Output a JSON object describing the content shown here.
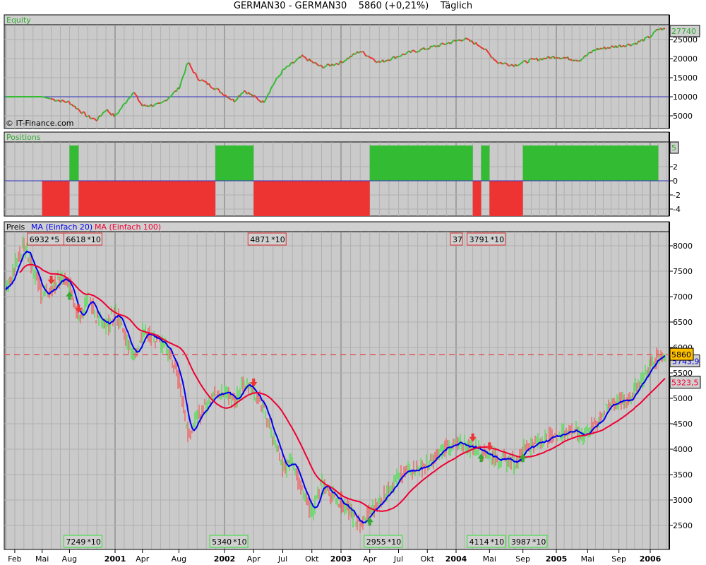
{
  "title": {
    "symbol": "GERMAN30 - GERMAN30",
    "last": "5860 (+0,21%)",
    "period": "Täglich"
  },
  "colors": {
    "up": "#33bb33",
    "down": "#ee3333",
    "ma20": "#0000ee",
    "ma100": "#ee0033",
    "panel_bg": "#cacaca",
    "last_box": "#ffc000"
  },
  "chart_data": [
    {
      "type": "line",
      "panel": "Equity",
      "title": "Equity",
      "watermark": "© IT-Finance.com",
      "y_ticks": [
        5000,
        10000,
        15000,
        20000,
        25000
      ],
      "ylim": [
        2000,
        28500
      ],
      "reference_line": 10000,
      "last_value": "27740",
      "series": [
        {
          "name": "Equity",
          "points": [
            [
              "2000-01",
              10000
            ],
            [
              "2000-05",
              10000
            ],
            [
              "2000-06",
              9440
            ],
            [
              "2000-08",
              8500
            ],
            [
              "2000-10",
              4800
            ],
            [
              "2000-11",
              3900
            ],
            [
              "2000-12",
              6670
            ],
            [
              "2001-01",
              4800
            ],
            [
              "2001-03",
              11300
            ],
            [
              "2001-04",
              7600
            ],
            [
              "2001-06",
              7960
            ],
            [
              "2001-08",
              12200
            ],
            [
              "2001-09",
              19070
            ],
            [
              "2001-10",
              15000
            ],
            [
              "2001-12",
              12200
            ],
            [
              "2002-02",
              8900
            ],
            [
              "2002-03",
              11670
            ],
            [
              "2002-05",
              8500
            ],
            [
              "2002-06",
              13150
            ],
            [
              "2002-07",
              16850
            ],
            [
              "2002-09",
              20550
            ],
            [
              "2002-11",
              17780
            ],
            [
              "2003-01",
              19000
            ],
            [
              "2003-03",
              22000
            ],
            [
              "2003-05",
              19000
            ],
            [
              "2003-08",
              21500
            ],
            [
              "2003-11",
              23300
            ],
            [
              "2004-02",
              25200
            ],
            [
              "2004-04",
              23300
            ],
            [
              "2004-06",
              19000
            ],
            [
              "2004-08",
              18300
            ],
            [
              "2004-10",
              19600
            ],
            [
              "2005-01",
              20500
            ],
            [
              "2005-04",
              19600
            ],
            [
              "2005-06",
              22400
            ],
            [
              "2005-09",
              23300
            ],
            [
              "2005-11",
              23900
            ],
            [
              "2006-01",
              25700
            ],
            [
              "2006-02",
              27740
            ]
          ]
        }
      ]
    },
    {
      "type": "bar",
      "panel": "Positions",
      "title": "Positions",
      "y_ticks": [
        -4,
        -2,
        0,
        2
      ],
      "ylim": [
        -5,
        5
      ],
      "last_value": "5",
      "segments": [
        {
          "from": "2000-05",
          "to": "2000-08",
          "value": -5
        },
        {
          "from": "2000-08",
          "to": "2000-09",
          "value": 5
        },
        {
          "from": "2000-09",
          "to": "2001-12",
          "value": -5
        },
        {
          "from": "2001-12",
          "to": "2002-04",
          "value": 5
        },
        {
          "from": "2002-04",
          "to": "2003-04",
          "value": -5
        },
        {
          "from": "2003-04",
          "to": "2004-03",
          "value": 5
        },
        {
          "from": "2004-03",
          "to": "2004-04",
          "value": -5
        },
        {
          "from": "2004-04",
          "to": "2004-05",
          "value": 5
        },
        {
          "from": "2004-05",
          "to": "2004-09",
          "value": -5
        },
        {
          "from": "2004-09",
          "to": "2006-02",
          "value": 5
        }
      ]
    },
    {
      "type": "line",
      "panel": "Preis",
      "legend": [
        "Preis",
        "MA (Einfach 20)",
        "MA (Einfach 100)"
      ],
      "y_ticks": [
        2500,
        3000,
        3500,
        4000,
        4500,
        5000,
        5500,
        6000,
        6500,
        7000,
        7500,
        8000
      ],
      "ylim": [
        2300,
        8250
      ],
      "last_price": "5860",
      "ma20_last": "5743,9",
      "ma100_last": "5323,5",
      "price": [
        [
          "2000-01",
          7140
        ],
        [
          "2000-03",
          8040
        ],
        [
          "2000-04",
          7555
        ],
        [
          "2000-05",
          7000
        ],
        [
          "2000-06",
          7140
        ],
        [
          "2000-07",
          7350
        ],
        [
          "2000-08",
          7200
        ],
        [
          "2000-09",
          6580
        ],
        [
          "2000-10",
          7000
        ],
        [
          "2000-11",
          6580
        ],
        [
          "2000-12",
          6375
        ],
        [
          "2001-01",
          6720
        ],
        [
          "2001-03",
          5820
        ],
        [
          "2001-04",
          6300
        ],
        [
          "2001-05",
          6240
        ],
        [
          "2001-07",
          5890
        ],
        [
          "2001-08",
          5330
        ],
        [
          "2001-09",
          4220
        ],
        [
          "2001-10",
          4640
        ],
        [
          "2001-12",
          5125
        ],
        [
          "2002-01",
          5125
        ],
        [
          "2002-02",
          4920
        ],
        [
          "2002-03",
          5330
        ],
        [
          "2002-04",
          5125
        ],
        [
          "2002-05",
          4780
        ],
        [
          "2002-06",
          4220
        ],
        [
          "2002-07",
          3600
        ],
        [
          "2002-08",
          3800
        ],
        [
          "2002-09",
          3110
        ],
        [
          "2002-10",
          2760
        ],
        [
          "2002-11",
          3320
        ],
        [
          "2002-12",
          3110
        ],
        [
          "2003-01",
          2970
        ],
        [
          "2003-03",
          2485
        ],
        [
          "2003-04",
          2760
        ],
        [
          "2003-05",
          2970
        ],
        [
          "2003-06",
          3250
        ],
        [
          "2003-08",
          3600
        ],
        [
          "2003-10",
          3670
        ],
        [
          "2003-12",
          4080
        ],
        [
          "2004-02",
          4080
        ],
        [
          "2004-04",
          4010
        ],
        [
          "2004-05",
          3870
        ],
        [
          "2004-08",
          3740
        ],
        [
          "2004-09",
          4010
        ],
        [
          "2004-11",
          4150
        ],
        [
          "2005-01",
          4290
        ],
        [
          "2005-03",
          4390
        ],
        [
          "2005-04",
          4250
        ],
        [
          "2005-06",
          4500
        ],
        [
          "2005-08",
          4920
        ],
        [
          "2005-10",
          4950
        ],
        [
          "2005-12",
          5400
        ],
        [
          "2006-02",
          5860
        ]
      ],
      "top_labels": [
        {
          "text": "6932",
          "mult": "*5",
          "date": "2000-04"
        },
        {
          "text": "6618",
          "mult": "*10",
          "date": "2000-08"
        },
        {
          "text": "4871",
          "mult": "*10",
          "date": "2002-04"
        },
        {
          "text": "37",
          "mult": "",
          "date": "2004-01"
        },
        {
          "text": "3791",
          "mult": "*10",
          "date": "2004-03"
        }
      ],
      "bottom_labels": [
        {
          "text": "7249",
          "mult": "*10",
          "date": "2000-08"
        },
        {
          "text": "5340",
          "mult": "*10",
          "date": "2001-12"
        },
        {
          "text": "2955",
          "mult": "*10",
          "date": "2003-04"
        },
        {
          "text": "4114",
          "mult": "*10",
          "date": "2004-03"
        },
        {
          "text": "3987",
          "mult": "*10",
          "date": "2004-08"
        }
      ],
      "signals": [
        {
          "date": "2000-08",
          "dir": "up"
        },
        {
          "date": "2000-09",
          "dir": "down"
        },
        {
          "date": "2000-06",
          "dir": "down"
        },
        {
          "date": "2002-04",
          "dir": "down"
        },
        {
          "date": "2003-04",
          "dir": "up"
        },
        {
          "date": "2004-03",
          "dir": "down"
        },
        {
          "date": "2004-04",
          "dir": "up"
        },
        {
          "date": "2004-05",
          "dir": "down"
        },
        {
          "date": "2004-09",
          "dir": "up"
        }
      ],
      "x_ticks": [
        {
          "label": "Feb",
          "date": "2000-02",
          "major": false
        },
        {
          "label": "Mai",
          "date": "2000-05",
          "major": false
        },
        {
          "label": "Aug",
          "date": "2000-08",
          "major": false
        },
        {
          "label": "2001",
          "date": "2001-01",
          "major": true
        },
        {
          "label": "Apr",
          "date": "2001-04",
          "major": false
        },
        {
          "label": "Aug",
          "date": "2001-08",
          "major": false
        },
        {
          "label": "2002",
          "date": "2002-01",
          "major": true
        },
        {
          "label": "Apr",
          "date": "2002-04",
          "major": false
        },
        {
          "label": "Jul",
          "date": "2002-07",
          "major": false
        },
        {
          "label": "Okt",
          "date": "2002-10",
          "major": false
        },
        {
          "label": "2003",
          "date": "2003-01",
          "major": true
        },
        {
          "label": "Apr",
          "date": "2003-04",
          "major": false
        },
        {
          "label": "Jul",
          "date": "2003-07",
          "major": false
        },
        {
          "label": "Okt",
          "date": "2003-10",
          "major": false
        },
        {
          "label": "2004",
          "date": "2004-01",
          "major": true
        },
        {
          "label": "Mai",
          "date": "2004-05",
          "major": false
        },
        {
          "label": "Sep",
          "date": "2004-09",
          "major": false
        },
        {
          "label": "2005",
          "date": "2005-01",
          "major": true
        },
        {
          "label": "Mai",
          "date": "2005-05",
          "major": false
        },
        {
          "label": "Sep",
          "date": "2005-09",
          "major": false
        },
        {
          "label": "2006",
          "date": "2006-01",
          "major": true
        }
      ]
    }
  ]
}
